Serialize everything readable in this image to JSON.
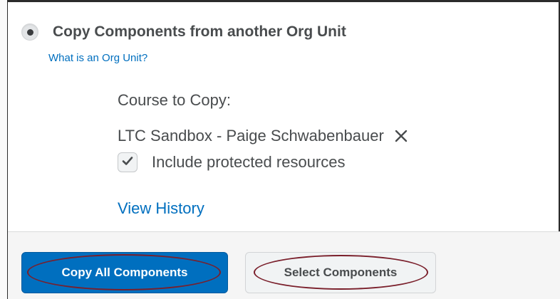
{
  "copy_option": {
    "radio_label": "Copy Components from another Org Unit",
    "help_link": "What is an Org Unit?"
  },
  "course": {
    "label": "Course to Copy:",
    "name": "LTC Sandbox - Paige Schwabenbauer",
    "remove_icon": "close-icon"
  },
  "protected": {
    "label": "Include protected resources",
    "checked": true,
    "icon": "checkmark-icon"
  },
  "history_link": "View History",
  "footer": {
    "copy_all_label": "Copy All Components",
    "select_label": "Select Components"
  },
  "colors": {
    "link": "#006fbf",
    "primary_button": "#006fbf",
    "text": "#494c4e",
    "annotation_oval": "#7a1f2b"
  }
}
